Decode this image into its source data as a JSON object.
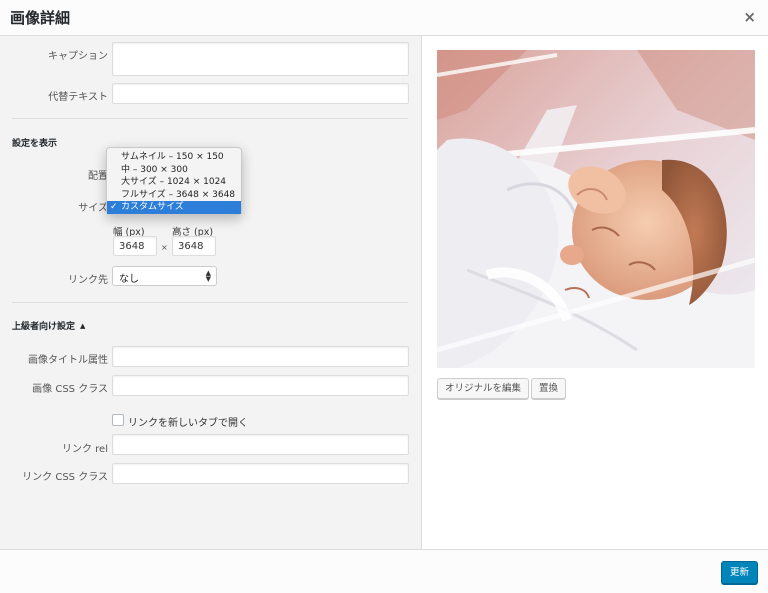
{
  "header": {
    "title": "画像詳細",
    "close_glyph": "×"
  },
  "fields": {
    "caption_label": "キャプション",
    "caption_value": "",
    "alt_label": "代替テキスト",
    "alt_value": ""
  },
  "display_settings": {
    "title": "設定を表示",
    "align_label": "配置",
    "size_label": "サイズ",
    "size_options": [
      "サムネイル – 150 × 150",
      "中 – 300 × 300",
      "大サイズ – 1024 × 1024",
      "フルサイズ – 3648 × 3648",
      "カスタムサイズ"
    ],
    "size_selected": "カスタムサイズ",
    "check_glyph": "✓",
    "width_label": "幅 (px)",
    "height_label": "高さ (px)",
    "width_value": "3648",
    "height_value": "3648",
    "times_glyph": "×",
    "link_label": "リンク先",
    "link_value": "なし"
  },
  "advanced": {
    "title": "上級者向け設定",
    "toggle_glyph": "▲",
    "image_title_label": "画像タイトル属性",
    "image_title_value": "",
    "image_css_label": "画像 CSS クラス",
    "image_css_value": "",
    "new_tab_label": "リンクを新しいタブで開く",
    "new_tab_checked": false,
    "link_rel_label": "リンク rel",
    "link_rel_value": "",
    "link_css_label": "リンク CSS クラス",
    "link_css_value": ""
  },
  "preview": {
    "edit_original_label": "オリジナルを編集",
    "replace_label": "置換"
  },
  "footer": {
    "update_label": "更新"
  },
  "colors": {
    "primary": "#0085ba",
    "selection": "#2d7ed8",
    "panel_bg": "#f3f3f3"
  }
}
